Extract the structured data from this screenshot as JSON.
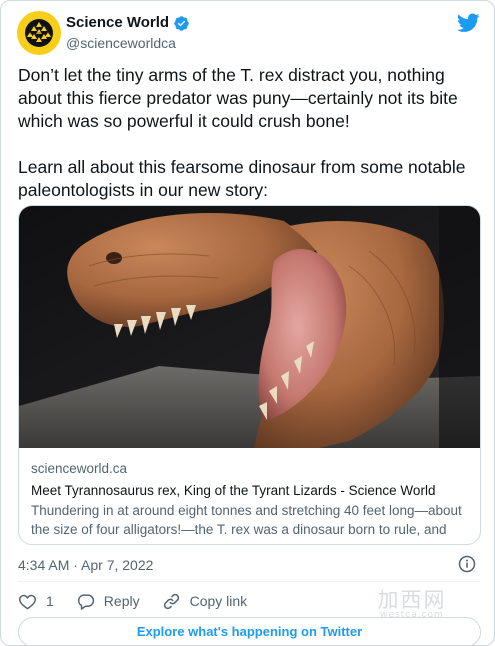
{
  "account": {
    "display_name": "Science World",
    "handle": "@scienceworldca",
    "verified": true,
    "brand_color": "#f7cf1a"
  },
  "tweet": {
    "paragraphs": [
      "Don’t let the tiny arms of the T. rex distract you, nothing about this fierce predator was puny—certainly not its bite which was so powerful it could crush bone!",
      "Learn all about this fearsome dinosaur from some notable paleontologists in our new story:"
    ],
    "timestamp": "4:34 AM · Apr 7, 2022"
  },
  "link_card": {
    "domain": "scienceworld.ca",
    "title": "Meet Tyrannosaurus rex, King of the Tyrant Lizards - Science World",
    "description": "Thundering in at around eight tonnes and stretching 40 feet long—about the size of four alligators!—the T. rex was a dinosaur born to rule, and ru..."
  },
  "actions": {
    "like_count": "1",
    "reply_label": "Reply",
    "copy_link_label": "Copy link"
  },
  "explore_label": "Explore what's happening on Twitter",
  "watermark": {
    "glyphs": "加西网",
    "url": "westca.com"
  },
  "colors": {
    "twitter_blue": "#1d9bf0",
    "secondary_text": "#536471",
    "border": "#cfd9de"
  },
  "icons": [
    "science-world-logo-icon",
    "verified-badge-icon",
    "twitter-bird-icon",
    "info-icon",
    "heart-icon",
    "reply-icon",
    "link-icon"
  ]
}
